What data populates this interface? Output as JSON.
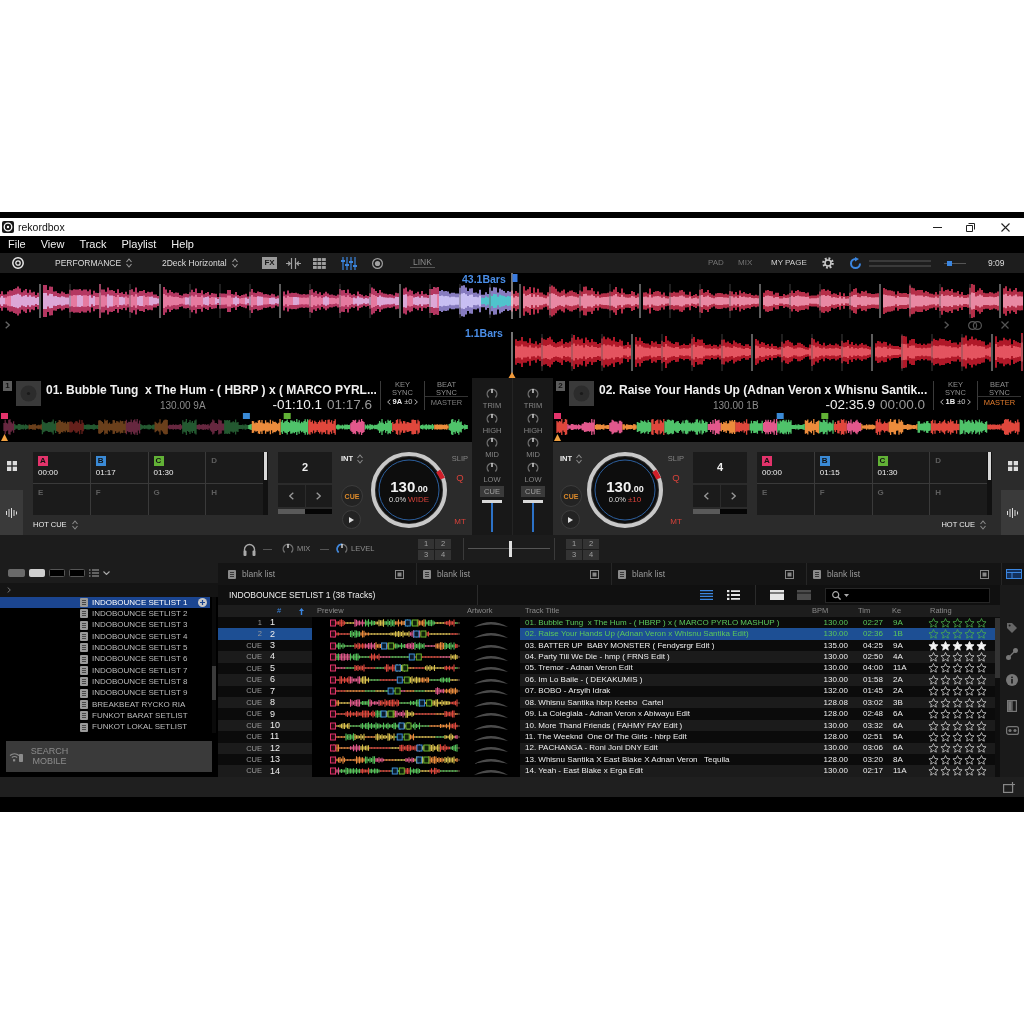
{
  "window": {
    "title": "rekordbox"
  },
  "menu": [
    "File",
    "View",
    "Track",
    "Playlist",
    "Help"
  ],
  "toolbar": {
    "mode": "PERFORMANCE",
    "layout": "2Deck Horizontal",
    "panels": [
      {
        "kind": "fx",
        "label": "FX",
        "on": false
      },
      {
        "kind": "split",
        "on": false
      },
      {
        "kind": "sampler",
        "on": false
      },
      {
        "kind": "mixer",
        "on": true
      },
      {
        "kind": "recorder",
        "on": false
      }
    ],
    "link": "LINK",
    "buttons": [
      {
        "label": "PAD",
        "disabled": true
      },
      {
        "label": "MIX",
        "disabled": true
      },
      {
        "label": "MY PAGE",
        "disabled": false
      }
    ],
    "master_meter": {
      "level": 0
    },
    "master_volume": {
      "level": 0.15
    },
    "clock": "9:09"
  },
  "waveforms": [
    {
      "bars": "43.1Bars"
    },
    {
      "bars": "1.1Bars"
    }
  ],
  "decks": [
    {
      "number": "1",
      "title": "01. Bubble Tung  x The Hum - ( HBRP ) x ( MARCO PYRL...",
      "bpm_key": "130.00 9A",
      "remaining": "-01:10.1",
      "elapsed": "01:17.6",
      "key_sync": "KEY SYNC",
      "key": "9A",
      "key_shift": "±0",
      "beat_sync": "BEAT SYNC",
      "master": {
        "label": "MASTER",
        "on": false
      },
      "hot_cues": [
        {
          "letter": "A",
          "time": "00:00",
          "color": "#e3336b"
        },
        {
          "letter": "B",
          "time": "01:17",
          "color": "#3a8ad6"
        },
        {
          "letter": "C",
          "time": "01:30",
          "color": "#62b236"
        },
        {
          "letter": "D"
        },
        {
          "letter": "E"
        },
        {
          "letter": "F"
        },
        {
          "letter": "G"
        },
        {
          "letter": "H"
        }
      ],
      "pad_mode": "HOT CUE",
      "loop": {
        "beats": "2",
        "level": 0.5
      },
      "int": "INT",
      "cue": "CUE",
      "tempo": "130",
      "tempo_decimals": ".00",
      "pitch": "0.0%",
      "range": "WIDE",
      "toggles": [
        {
          "label": "SLIP",
          "on": false
        },
        {
          "label": "Q",
          "on": true
        },
        {
          "label": "MT",
          "on": true
        }
      ]
    },
    {
      "number": "2",
      "title": "02. Raise Your Hands Up (Adnan Veron x Whisnu Santik...",
      "bpm_key": "130.00 1B",
      "remaining": "-02:35.9",
      "elapsed": "00:00.0",
      "key_sync": "KEY SYNC",
      "key": "1B",
      "key_shift": "±0",
      "beat_sync": "BEAT SYNC",
      "master": {
        "label": "MASTER",
        "on": true
      },
      "hot_cues": [
        {
          "letter": "A",
          "time": "00:00",
          "color": "#e3336b"
        },
        {
          "letter": "B",
          "time": "01:15",
          "color": "#3a8ad6"
        },
        {
          "letter": "C",
          "time": "01:30",
          "color": "#62b236"
        },
        {
          "letter": "D"
        },
        {
          "letter": "E"
        },
        {
          "letter": "F"
        },
        {
          "letter": "G"
        },
        {
          "letter": "H"
        }
      ],
      "pad_mode": "HOT CUE",
      "loop": {
        "beats": "4",
        "level": 0.5
      },
      "int": "INT",
      "cue": "CUE",
      "tempo": "130",
      "tempo_decimals": ".00",
      "pitch": "0.0%",
      "range": "±10",
      "toggles": [
        {
          "label": "SLIP",
          "on": false
        },
        {
          "label": "Q",
          "on": true
        },
        {
          "label": "MT",
          "on": true
        }
      ]
    }
  ],
  "mixer": {
    "channels": [
      {
        "knobs": [
          "TRIM",
          "HIGH",
          "MID",
          "LOW"
        ],
        "cue": "CUE",
        "fader": {
          "level": 1
        }
      },
      {
        "knobs": [
          "TRIM",
          "HIGH",
          "MID",
          "LOW"
        ],
        "cue": "CUE",
        "fader": {
          "level": 1
        }
      }
    ],
    "mix": "MIX",
    "level": "LEVEL",
    "fx_assign": [
      [
        "1",
        "2",
        "3",
        "4"
      ],
      [
        "1",
        "2",
        "3",
        "4"
      ]
    ],
    "crossfader": {
      "level": 0.5
    }
  },
  "browser": {
    "sidebar": {
      "items": [
        {
          "label": "INDOBOUNCE SETLIST 1",
          "selected": true
        },
        {
          "label": "INDOBOUNCE SETLIST 2",
          "selected": false
        },
        {
          "label": "INDOBOUNCE SETLIST 3",
          "selected": false
        },
        {
          "label": "INDOBOUNCE SETLIST 4",
          "selected": false
        },
        {
          "label": "INDOBOUNCE SETLIST 5",
          "selected": false
        },
        {
          "label": "INDOBOUNCE SETLIST 6",
          "selected": false
        },
        {
          "label": "INDOBOUNCE SETLIST 7",
          "selected": false
        },
        {
          "label": "INDOBOUNCE SETLIST 8",
          "selected": false
        },
        {
          "label": "INDOBOUNCE SETLIST 9",
          "selected": false
        },
        {
          "label": "BREAKBEAT RYCKO RIA",
          "selected": false
        },
        {
          "label": "FUNKOT BARAT SETLIST",
          "selected": false
        },
        {
          "label": "FUNKOT LOKAL SETLIST",
          "selected": false
        }
      ],
      "search_mobile": "SEARCH MOBILE"
    },
    "tabs": [
      "blank list",
      "blank list",
      "blank list",
      "blank list"
    ],
    "playlist_title": "INDOBOUNCE SETLIST 1 (38 Tracks)",
    "view_modes": [
      {
        "kind": "list",
        "selected": true,
        "disabled": false
      },
      {
        "kind": "bullets",
        "selected": false,
        "disabled": false
      },
      {
        "kind": "tiles",
        "selected": false,
        "disabled": false
      },
      {
        "kind": "tiles",
        "selected": false,
        "disabled": true
      }
    ],
    "columns": [
      {
        "label": "#",
        "sorted": true
      },
      {
        "label": "Preview",
        "sorted": false
      },
      {
        "label": "Artwork",
        "sorted": false
      },
      {
        "label": "Track Title",
        "sorted": false
      },
      {
        "label": "BPM",
        "sorted": false
      },
      {
        "label": "Tim",
        "sorted": false
      },
      {
        "label": "Ke",
        "sorted": false
      },
      {
        "label": "Rating",
        "sorted": false
      }
    ],
    "rows": [
      {
        "deck": "1",
        "number": "1",
        "title": "01. Bubble Tung  x The Hum - ( HBRP ) x ( MARCO PYRLO MASHUP )",
        "bpm": "130.00",
        "time": "02:27",
        "key": "9A",
        "stars": 0,
        "loaded": true,
        "selected": false
      },
      {
        "deck": "2",
        "number": "2",
        "title": "02. Raise Your Hands Up (Adnan Veron x Whisnu Santika Edit)",
        "bpm": "130.00",
        "time": "02:36",
        "key": "1B",
        "stars": 0,
        "loaded": true,
        "selected": true
      },
      {
        "deck": "CUE",
        "number": "3",
        "title": "03. BATTER UP  BABY MONSTER ( Fendysrgr Edit )",
        "bpm": "135.00",
        "time": "04:25",
        "key": "9A",
        "stars": 5,
        "loaded": false,
        "selected": false
      },
      {
        "deck": "CUE",
        "number": "4",
        "title": "04. Party Till We Die - hmp ( FRNS Edit )",
        "bpm": "130.00",
        "time": "02:50",
        "key": "4A",
        "stars": 0,
        "loaded": false,
        "selected": false
      },
      {
        "deck": "CUE",
        "number": "5",
        "title": "05. Tremor - Adnan Veron Edit",
        "bpm": "130.00",
        "time": "04:00",
        "key": "11A",
        "stars": 0,
        "loaded": false,
        "selected": false
      },
      {
        "deck": "CUE",
        "number": "6",
        "title": "06. Im Lo Baile - ( DEKAKUMIS )",
        "bpm": "130.00",
        "time": "01:58",
        "key": "2A",
        "stars": 0,
        "loaded": false,
        "selected": false
      },
      {
        "deck": "CUE",
        "number": "7",
        "title": "07. BOBO - Arsyih Idrak",
        "bpm": "132.00",
        "time": "01:45",
        "key": "2A",
        "stars": 0,
        "loaded": false,
        "selected": false
      },
      {
        "deck": "CUE",
        "number": "8",
        "title": "08. Whisnu Santika hbrp Keebo  Cartel",
        "bpm": "128.08",
        "time": "03:02",
        "key": "3B",
        "stars": 0,
        "loaded": false,
        "selected": false
      },
      {
        "deck": "CUE",
        "number": "9",
        "title": "09. La Colegiala - Adnan Veron x Abiwayu Edit",
        "bpm": "128.00",
        "time": "02:48",
        "key": "6A",
        "stars": 0,
        "loaded": false,
        "selected": false
      },
      {
        "deck": "CUE",
        "number": "10",
        "title": "10. More Thand Friends ( FAHMY FAY Edit )",
        "bpm": "130.00",
        "time": "03:32",
        "key": "6A",
        "stars": 0,
        "loaded": false,
        "selected": false
      },
      {
        "deck": "CUE",
        "number": "11",
        "title": "11. The Weeknd  One Of The Girls - hbrp Edit",
        "bpm": "128.00",
        "time": "02:51",
        "key": "5A",
        "stars": 0,
        "loaded": false,
        "selected": false
      },
      {
        "deck": "CUE",
        "number": "12",
        "title": "12. PACHANGA - Roni Joni DNY Edit",
        "bpm": "130.00",
        "time": "03:06",
        "key": "6A",
        "stars": 0,
        "loaded": false,
        "selected": false
      },
      {
        "deck": "CUE",
        "number": "13",
        "title": "13. Whisnu Santika X East Blake X Adnan Veron   Tequila",
        "bpm": "128.00",
        "time": "03:20",
        "key": "8A",
        "stars": 0,
        "loaded": false,
        "selected": false
      },
      {
        "deck": "CUE",
        "number": "14",
        "title": "14. Yeah - East Blake x Erga Edit",
        "bpm": "130.00",
        "time": "02:17",
        "key": "11A",
        "stars": 0,
        "loaded": false,
        "selected": false
      }
    ]
  }
}
